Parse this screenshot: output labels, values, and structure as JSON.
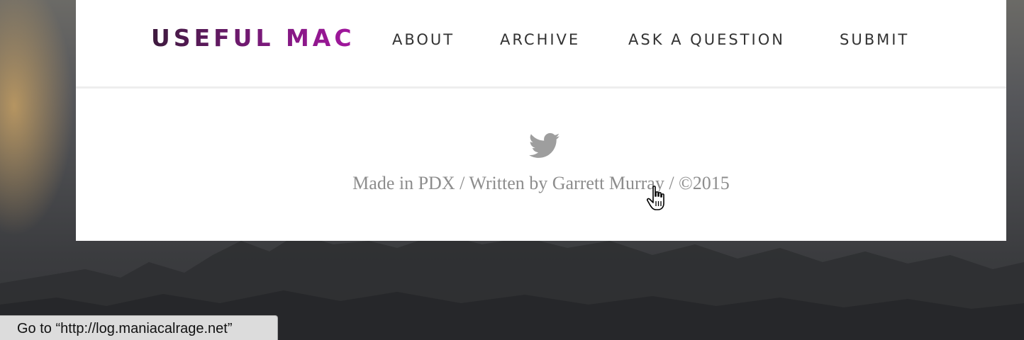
{
  "site": {
    "logo": "USEFUL MAC",
    "nav": [
      {
        "label": "ABOUT"
      },
      {
        "label": "ARCHIVE"
      },
      {
        "label": "ASK A QUESTION"
      },
      {
        "label": "SUBMIT"
      }
    ]
  },
  "footer": {
    "credit": "Made in PDX / Written by Garrett Murray / ©2015",
    "icon": "twitter-icon"
  },
  "status_bar": {
    "text": "Go to “http://log.maniacalrage.net”"
  },
  "colors": {
    "logo_gradient_start": "#3d1a3d",
    "logo_gradient_end": "#a3169f",
    "nav_text": "#333333",
    "footer_text": "#8d8d8d",
    "card_background": "#ffffff"
  }
}
